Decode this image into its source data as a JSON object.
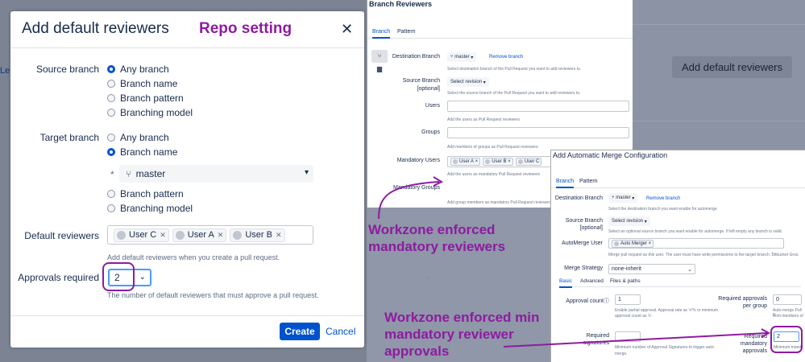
{
  "background": {
    "add_reviewers_button": "Add default reviewers",
    "left_link_fragment": "Lea"
  },
  "dialog": {
    "title": "Add default reviewers",
    "annotation": "Repo setting",
    "close_icon": "close-icon",
    "source_branch": {
      "label": "Source branch",
      "options": [
        "Any branch",
        "Branch name",
        "Branch pattern",
        "Branching model"
      ],
      "selected": "Any branch"
    },
    "target_branch": {
      "label": "Target branch",
      "options": [
        "Any branch",
        "Branch name",
        "Branch pattern",
        "Branching model"
      ],
      "selected": "Branch name",
      "branch_value": "master",
      "required_mark": "*"
    },
    "default_reviewers": {
      "label": "Default reviewers",
      "users": [
        "User C",
        "User A",
        "User B"
      ],
      "help": "Add default reviewers when you create a pull request."
    },
    "approvals": {
      "label": "Approvals required",
      "value": "2",
      "help": "The number of default reviewers that must approve a pull request."
    },
    "create_label": "Create",
    "cancel_label": "Cancel"
  },
  "branch_reviewers": {
    "title": "Branch Reviewers",
    "tabs": [
      "Branch",
      "Pattern"
    ],
    "active_tab": "Branch",
    "destination_label": "Destination Branch",
    "destination_value": "master",
    "remove_branch": "Remove branch",
    "destination_help": "Select destination branch of the Pull Request you want to add reviewers to.",
    "source_label_1": "Source Branch",
    "source_label_2": "[optional]",
    "source_value": "Select revision",
    "source_help": "Select the source branch of the Pull Request you want to add reviewers to.",
    "users_label": "Users",
    "users_help": "Add the users as Pull Request reviewers",
    "groups_label": "Groups",
    "groups_help": "Add members of groups as Pull Request reviewers",
    "mandatory_users_label": "Mandatory Users",
    "mandatory_users": [
      "User A",
      "User B",
      "User C"
    ],
    "mandatory_users_help": "Add the users as mandatory Pull Request reviewers",
    "mandatory_groups_label": "Mandatory Groups",
    "mandatory_groups_help": "Add group members as mandatory Pull Request reviewers"
  },
  "annotation_reviewers": {
    "line1": "Workzone enforced",
    "line2": "mandatory reviewers"
  },
  "auto_merge": {
    "title": "Add Automatic Merge Configuration",
    "tabs": [
      "Branch",
      "Pattern"
    ],
    "active_tab": "Branch",
    "destination_label": "Destination Branch",
    "destination_value": "master",
    "remove_branch": "Remove branch",
    "destination_help": "Select the destination branch you want enable for automerge",
    "source_label_1": "Source Branch",
    "source_label_2": "[optional]",
    "source_value": "Select revision",
    "source_help": "Select an optional source branch you want enable for automerge. If left empty any branch is valid.",
    "automerge_user_label": "AutoMerge User",
    "automerge_user_value": "Auto Merger",
    "automerge_user_help": "Merge pull request as this user. The user must have write permissions to the target branch. Bitbucket Grou",
    "merge_strategy_label": "Merge Strategy",
    "merge_strategy_value": "none-inherit",
    "subtabs": [
      "Basic",
      "Advanced",
      "Files & paths"
    ],
    "active_subtab": "Basic",
    "approval_count_label": "Approval count",
    "approval_count_value": "1",
    "approval_count_help_1": "Enable partial approval. Approval rate as 'n'% or minimum",
    "approval_count_help_2": "approval count as 'n'.",
    "required_approvals_group_label_1": "Required approvals",
    "required_approvals_group_label_2": "per group",
    "required_approvals_group_value": "0",
    "required_approvals_group_help_1": "Auto-merge Pull R",
    "required_approvals_group_help_2": "from members of",
    "required_signatures_label_1": "Required",
    "required_signatures_label_2": "signatures",
    "required_signatures_help_1": "Minimum number of Approval Signatures to trigger auto-",
    "required_signatures_help_2": "merge.",
    "required_mandatory_label_1": "Required",
    "required_mandatory_label_2": "mandatory",
    "required_mandatory_label_3": "approvals",
    "required_mandatory_value": "2",
    "required_mandatory_help": "Minimum mand"
  },
  "annotation_approvals": {
    "line1": "Workzone enforced min",
    "line2": "mandatory reviewer",
    "line3": "approvals"
  },
  "colors": {
    "accent": "#0052cc",
    "annotation": "#8e1ba0"
  }
}
